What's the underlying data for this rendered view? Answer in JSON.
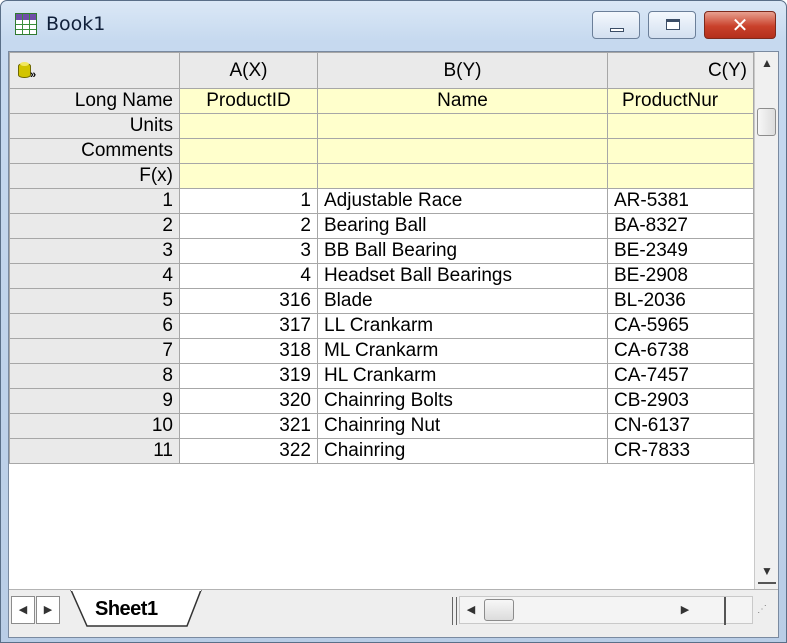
{
  "window": {
    "title": "Book1",
    "icon": "workbook-grid-icon",
    "buttons": {
      "minimize": "minimize-icon",
      "maximize": "maximize-icon",
      "close": "close-icon"
    }
  },
  "worksheet": {
    "corner_icon": "database-connector-icon",
    "columns": [
      "A(X)",
      "B(Y)",
      "C(Y)"
    ],
    "label_rows": [
      {
        "label": "Long Name",
        "values": [
          "ProductID",
          "Name",
          "ProductNur"
        ]
      },
      {
        "label": "Units",
        "values": [
          "",
          "",
          ""
        ]
      },
      {
        "label": "Comments",
        "values": [
          "",
          "",
          ""
        ]
      },
      {
        "label": "F(x)",
        "values": [
          "",
          "",
          ""
        ]
      }
    ],
    "rows": [
      {
        "index": "1",
        "values": [
          "1",
          "Adjustable Race",
          "AR-5381"
        ]
      },
      {
        "index": "2",
        "values": [
          "2",
          "Bearing Ball",
          "BA-8327"
        ]
      },
      {
        "index": "3",
        "values": [
          "3",
          "BB Ball Bearing",
          "BE-2349"
        ]
      },
      {
        "index": "4",
        "values": [
          "4",
          "Headset Ball Bearings",
          "BE-2908"
        ]
      },
      {
        "index": "5",
        "values": [
          "316",
          "Blade",
          "BL-2036"
        ]
      },
      {
        "index": "6",
        "values": [
          "317",
          "LL Crankarm",
          "CA-5965"
        ]
      },
      {
        "index": "7",
        "values": [
          "318",
          "ML Crankarm",
          "CA-6738"
        ]
      },
      {
        "index": "8",
        "values": [
          "319",
          "HL Crankarm",
          "CA-7457"
        ]
      },
      {
        "index": "9",
        "values": [
          "320",
          "Chainring Bolts",
          "CB-2903"
        ]
      },
      {
        "index": "10",
        "values": [
          "321",
          "Chainring Nut",
          "CN-6137"
        ]
      },
      {
        "index": "11",
        "values": [
          "322",
          "Chainring",
          "CR-7833"
        ]
      }
    ]
  },
  "tabs": {
    "active": "Sheet1"
  },
  "scroll_glyphs": {
    "up": "▲",
    "down": "▼",
    "left": "◀",
    "right": "▶"
  },
  "colors": {
    "label_row_bg": "#ffffcc",
    "header_bg": "#eaeaea",
    "close_button": "#c9412b"
  }
}
